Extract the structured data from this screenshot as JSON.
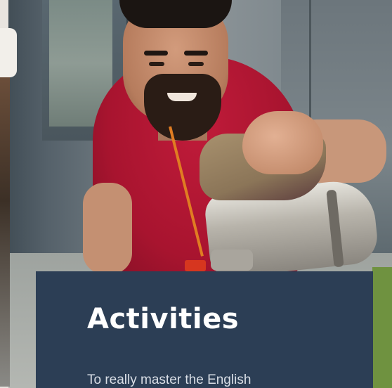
{
  "card": {
    "title": "Activities",
    "text": "To really master the English"
  },
  "theme": {
    "card_background": "#2c3e55",
    "title_color": "#ffffff",
    "text_color": "#d9dee6"
  }
}
